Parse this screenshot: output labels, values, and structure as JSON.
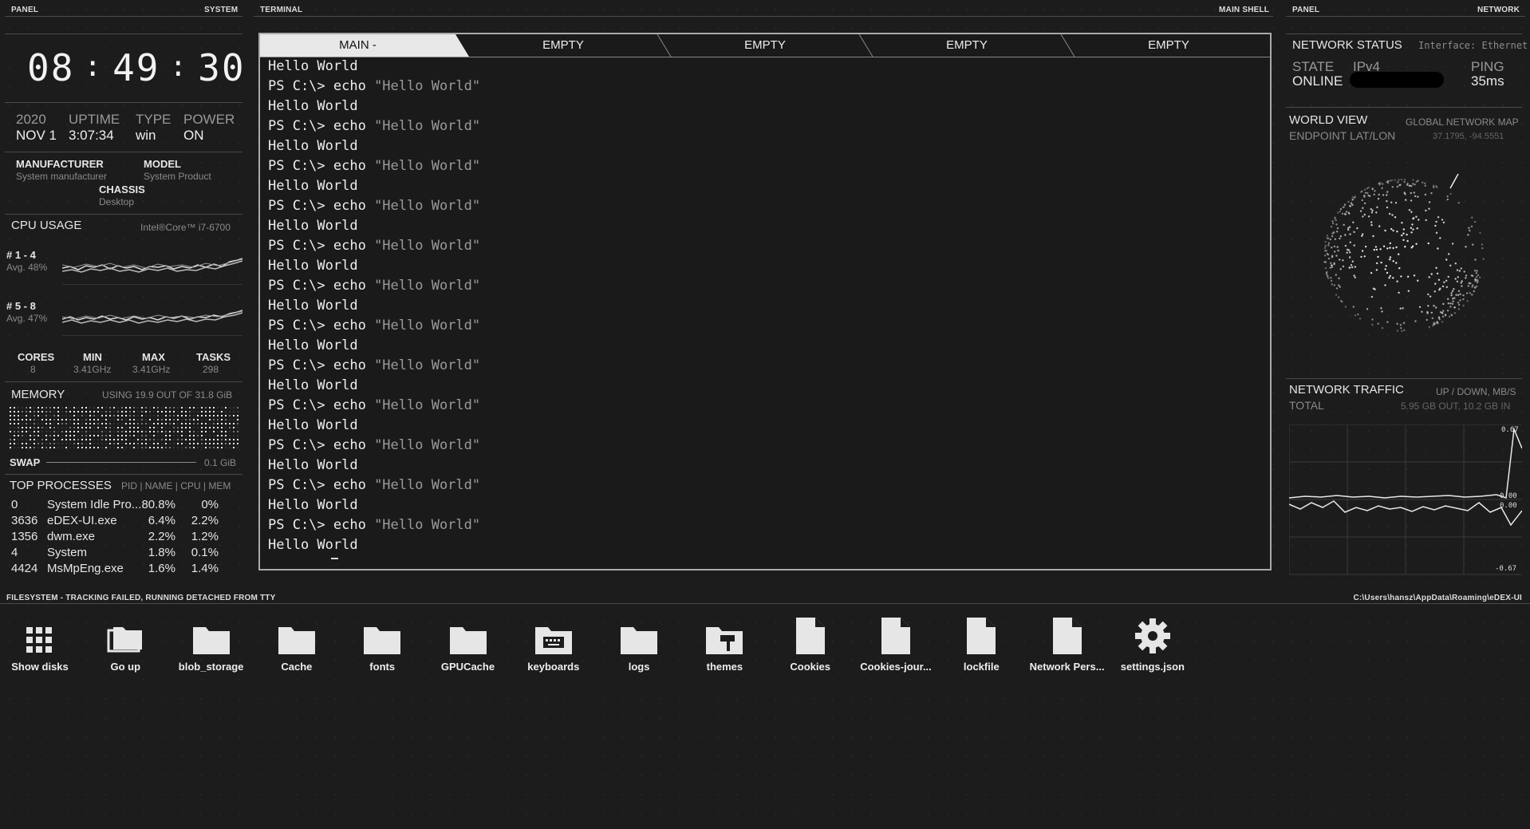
{
  "headers": {
    "left_panel": "PANEL",
    "left_system": "SYSTEM",
    "terminal": "TERMINAL",
    "main_shell": "MAIN SHELL",
    "right_panel": "PANEL",
    "right_network": "NETWORK",
    "filesystem": "FILESYSTEM - TRACKING FAILED, RUNNING DETACHED FROM TTY",
    "path": "C:\\Users\\hansz\\AppData\\Roaming\\eDEX-UI"
  },
  "clock": {
    "h": "08",
    "m": "49",
    "s": "30"
  },
  "sysinfo": {
    "year_label": "2020",
    "date": "NOV 1",
    "uptime_label": "UPTIME",
    "uptime": "3:07:34",
    "type_label": "TYPE",
    "type": "win",
    "power_label": "POWER",
    "power": "ON"
  },
  "hardware": {
    "manufacturer_label": "MANUFACTURER",
    "manufacturer": "System manufacturer",
    "model_label": "MODEL",
    "model": "System Product",
    "chassis_label": "CHASSIS",
    "chassis": "Desktop"
  },
  "cpu": {
    "title": "CPU USAGE",
    "name": "Intel®Core™ i7-6700",
    "g1_label": "# 1 - 4",
    "g1_avg": "Avg. 48%",
    "g2_label": "# 5 - 8",
    "g2_avg": "Avg. 47%",
    "cores_label": "CORES",
    "cores": "8",
    "min_label": "MIN",
    "min": "3.41GHz",
    "max_label": "MAX",
    "max": "3.41GHz",
    "tasks_label": "TASKS",
    "tasks": "298"
  },
  "memory": {
    "title": "MEMORY",
    "usage": "USING 19.9 OUT OF 31.8 GiB",
    "swap_label": "SWAP",
    "swap": "0.1 GiB"
  },
  "processes": {
    "title": "TOP PROCESSES",
    "columns": "PID | NAME | CPU | MEM",
    "rows": [
      {
        "pid": "0",
        "name": "System Idle Pro...",
        "cpu": "80.8%",
        "mem": "0%"
      },
      {
        "pid": "3636",
        "name": "eDEX-UI.exe",
        "cpu": "6.4%",
        "mem": "2.2%"
      },
      {
        "pid": "1356",
        "name": "dwm.exe",
        "cpu": "2.2%",
        "mem": "1.2%"
      },
      {
        "pid": "4",
        "name": "System",
        "cpu": "1.8%",
        "mem": "0.1%"
      },
      {
        "pid": "4424",
        "name": "MsMpEng.exe",
        "cpu": "1.6%",
        "mem": "1.4%"
      }
    ]
  },
  "terminal": {
    "tabs": [
      "MAIN -",
      "EMPTY",
      "EMPTY",
      "EMPTY",
      "EMPTY"
    ],
    "output": "Hello World",
    "prompt": "PS C:\\> echo ",
    "arg": "\"Hello World\""
  },
  "network": {
    "title": "NETWORK STATUS",
    "interface": "Interface: Ethernet",
    "state_label": "STATE",
    "state": "ONLINE",
    "ipv4_label": "IPv4",
    "ping_label": "PING",
    "ping": "35ms"
  },
  "world": {
    "title": "WORLD VIEW",
    "subtitle": "GLOBAL NETWORK MAP",
    "endpoint_label": "ENDPOINT LAT/LON",
    "endpoint": "37.1795, -94.5551"
  },
  "traffic": {
    "title": "NETWORK TRAFFIC",
    "units": "UP / DOWN, MB/S",
    "total_label": "TOTAL",
    "total": "5.95 GB OUT, 10.2 GB IN",
    "up_max": "0.67",
    "up_zero": "0.00",
    "down_zero": "0.00",
    "down_min": "-0.67"
  },
  "files": [
    {
      "name": "Show disks",
      "icon": "grid-icon"
    },
    {
      "name": "Go up",
      "icon": "folder-up-icon"
    },
    {
      "name": "blob_storage",
      "icon": "folder-icon"
    },
    {
      "name": "Cache",
      "icon": "folder-icon"
    },
    {
      "name": "fonts",
      "icon": "folder-icon"
    },
    {
      "name": "GPUCache",
      "icon": "folder-icon"
    },
    {
      "name": "keyboards",
      "icon": "keyboard-folder-icon"
    },
    {
      "name": "logs",
      "icon": "folder-icon"
    },
    {
      "name": "themes",
      "icon": "theme-folder-icon"
    },
    {
      "name": "Cookies",
      "icon": "file-icon"
    },
    {
      "name": "Cookies-jour...",
      "icon": "file-icon"
    },
    {
      "name": "lockfile",
      "icon": "file-icon"
    },
    {
      "name": "Network Pers...",
      "icon": "file-icon"
    },
    {
      "name": "settings.json",
      "icon": "gear-icon"
    }
  ]
}
